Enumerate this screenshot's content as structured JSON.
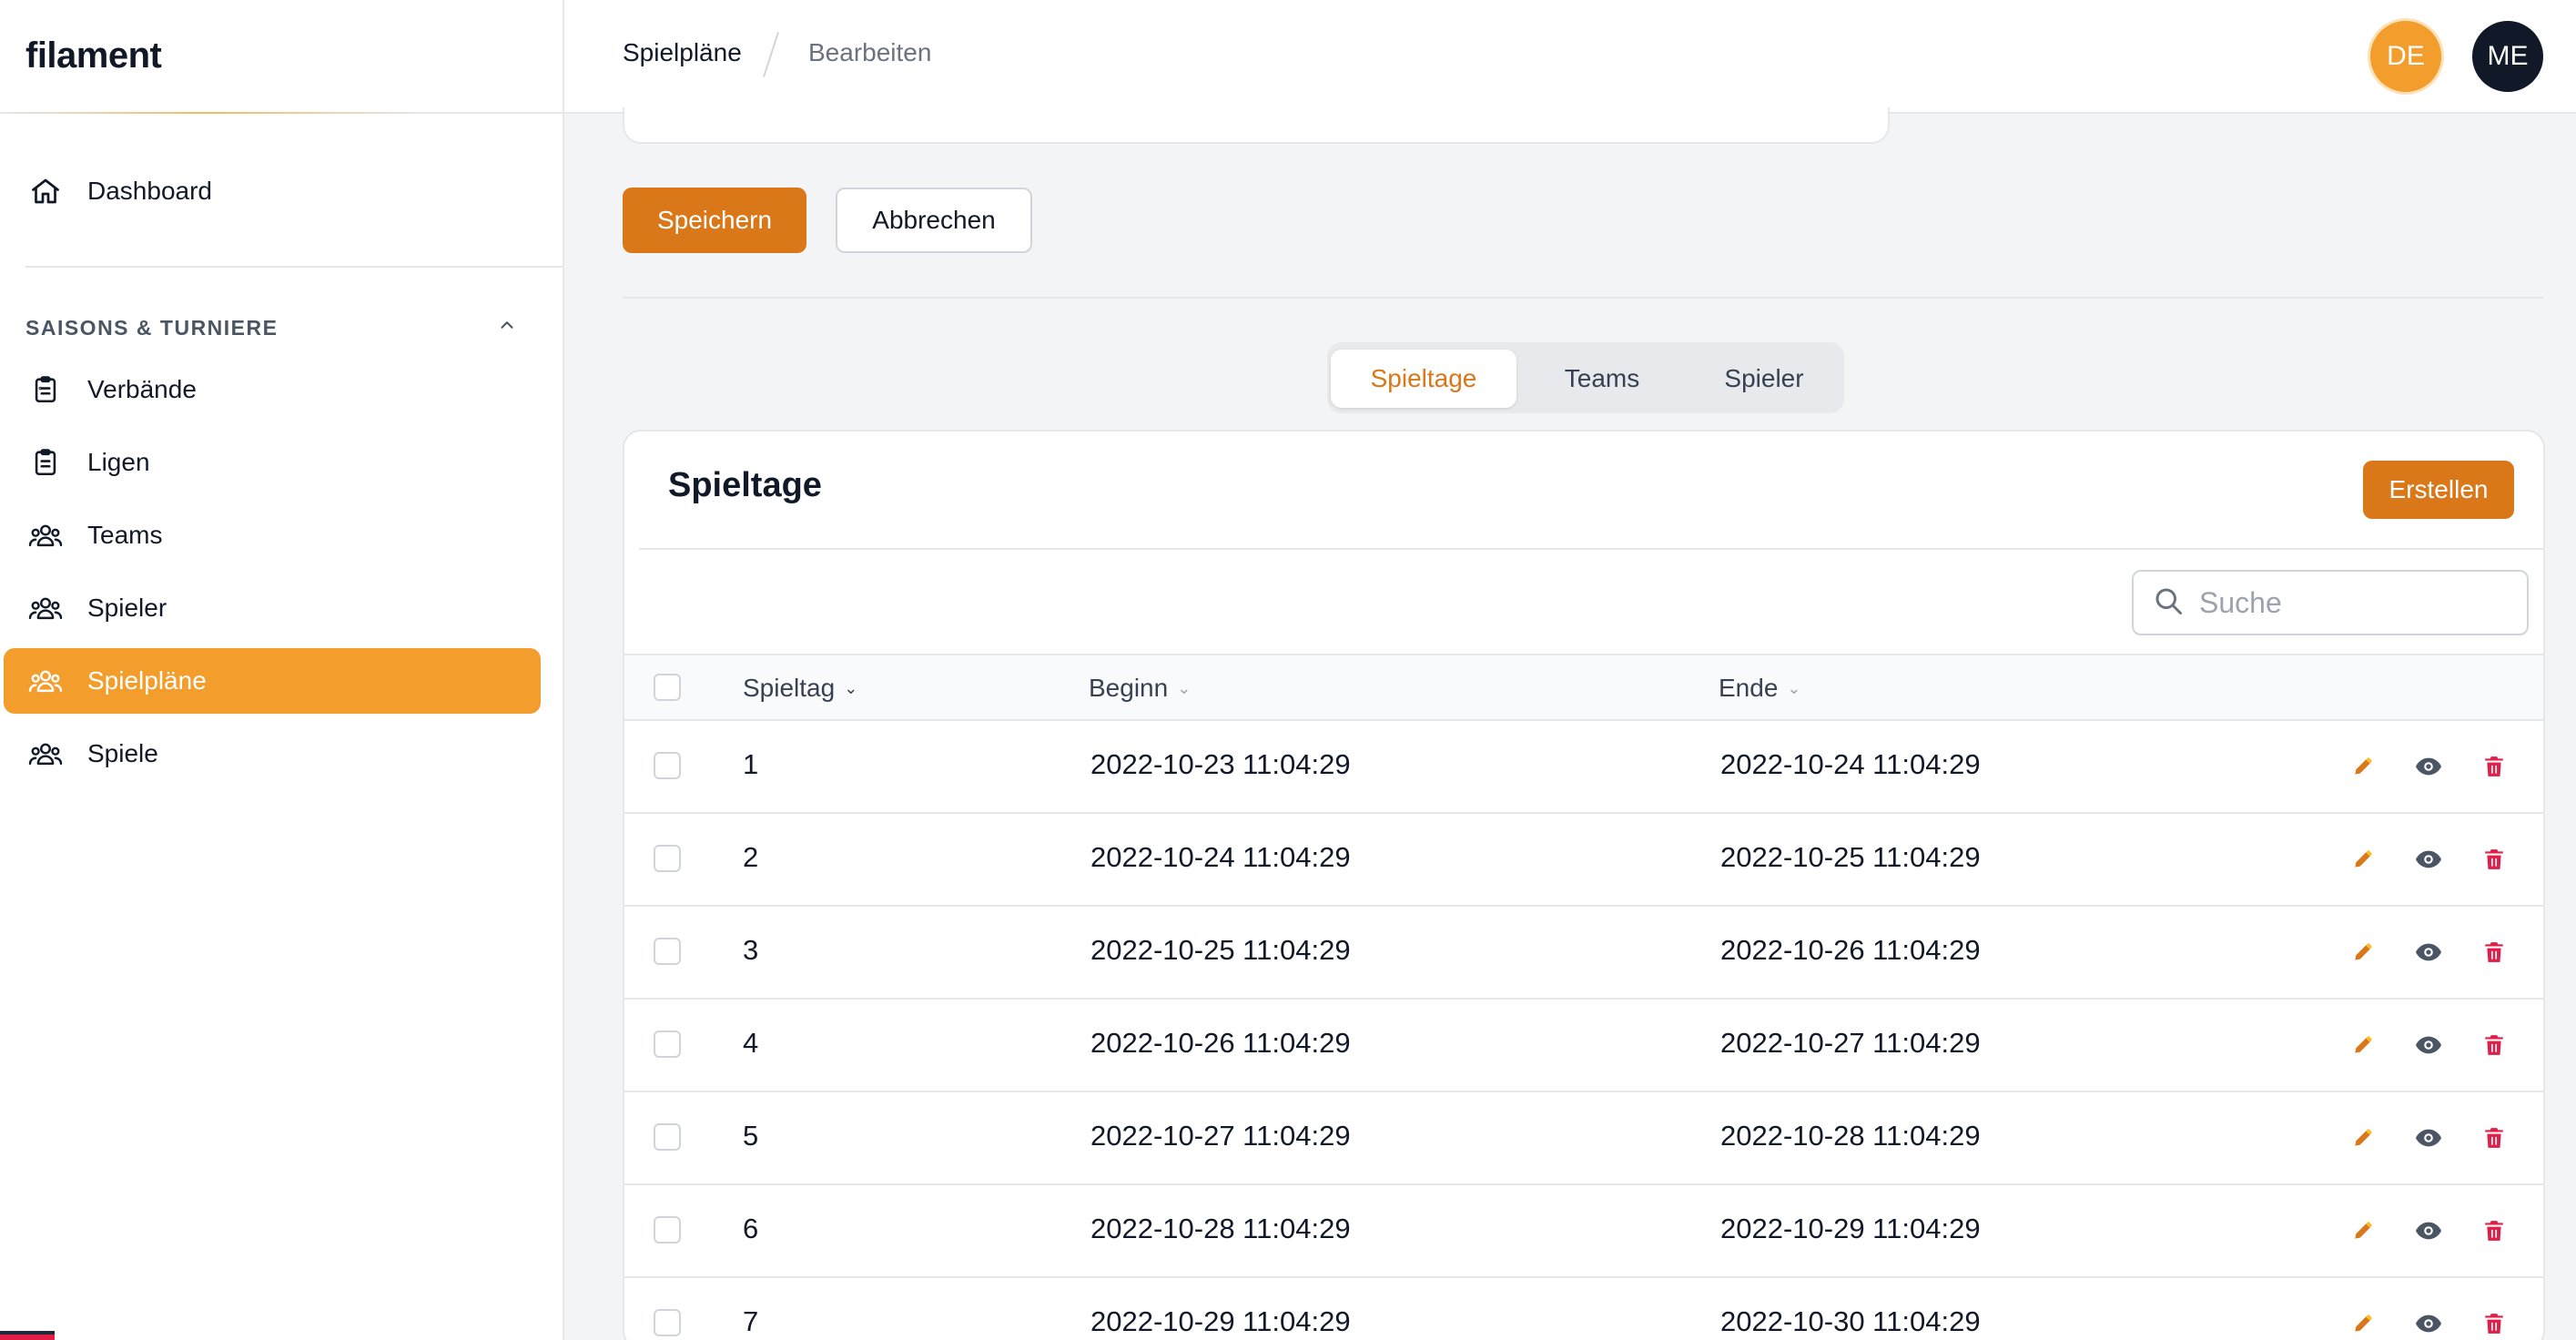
{
  "brand": "filament",
  "sidebar": {
    "dashboard": "Dashboard",
    "group_label": "SAISONS & TURNIERE",
    "items": [
      {
        "label": "Verbände",
        "icon": "clipboard-list-icon"
      },
      {
        "label": "Ligen",
        "icon": "clipboard-list-icon"
      },
      {
        "label": "Teams",
        "icon": "user-group-icon"
      },
      {
        "label": "Spieler",
        "icon": "user-group-icon"
      },
      {
        "label": "Spielpläne",
        "icon": "user-group-icon",
        "active": true
      },
      {
        "label": "Spiele",
        "icon": "user-group-icon"
      }
    ]
  },
  "breadcrumb": [
    "Spielpläne",
    "Bearbeiten"
  ],
  "avatars": [
    "DE",
    "ME"
  ],
  "form_actions": {
    "save": "Speichern",
    "cancel": "Abbrechen"
  },
  "tabs": [
    {
      "label": "Spieltage",
      "active": true
    },
    {
      "label": "Teams"
    },
    {
      "label": "Spieler"
    }
  ],
  "table": {
    "title": "Spieltage",
    "create_label": "Erstellen",
    "search_placeholder": "Suche",
    "columns": [
      "Spieltag",
      "Beginn",
      "Ende"
    ],
    "rows": [
      {
        "spieltag": "1",
        "beginn": "2022-10-23 11:04:29",
        "ende": "2022-10-24 11:04:29"
      },
      {
        "spieltag": "2",
        "beginn": "2022-10-24 11:04:29",
        "ende": "2022-10-25 11:04:29"
      },
      {
        "spieltag": "3",
        "beginn": "2022-10-25 11:04:29",
        "ende": "2022-10-26 11:04:29"
      },
      {
        "spieltag": "4",
        "beginn": "2022-10-26 11:04:29",
        "ende": "2022-10-27 11:04:29"
      },
      {
        "spieltag": "5",
        "beginn": "2022-10-27 11:04:29",
        "ende": "2022-10-28 11:04:29"
      },
      {
        "spieltag": "6",
        "beginn": "2022-10-28 11:04:29",
        "ende": "2022-10-29 11:04:29"
      },
      {
        "spieltag": "7",
        "beginn": "2022-10-29 11:04:29",
        "ende": "2022-10-30 11:04:29"
      }
    ]
  },
  "colors": {
    "primary": "#d97719",
    "active_nav": "#f29d2c",
    "danger": "#e11d48",
    "view_icon": "#4b5563"
  }
}
